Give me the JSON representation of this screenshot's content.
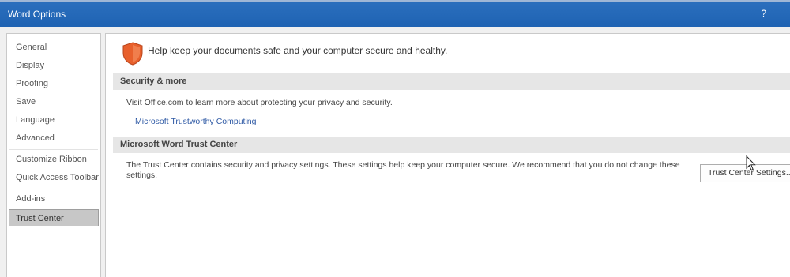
{
  "window": {
    "title": "Word Options",
    "help": "?"
  },
  "nav": {
    "items": [
      {
        "label": "General"
      },
      {
        "label": "Display"
      },
      {
        "label": "Proofing"
      },
      {
        "label": "Save"
      },
      {
        "label": "Language"
      },
      {
        "label": "Advanced"
      },
      {
        "label": "Customize Ribbon"
      },
      {
        "label": "Quick Access Toolbar"
      },
      {
        "label": "Add-ins"
      },
      {
        "label": "Trust Center"
      }
    ],
    "selected": "Trust Center"
  },
  "content": {
    "intro": "Help keep your documents safe and your computer secure and healthy.",
    "security_section": {
      "header": "Security & more",
      "text": "Visit Office.com to learn more about protecting your privacy and security.",
      "link": "Microsoft Trustworthy Computing"
    },
    "trust_center_section": {
      "header": "Microsoft Word Trust Center",
      "text_line1": "The Trust Center contains security and privacy settings. These settings help keep your computer secure. We recommend that you do not change these",
      "text_line2": "settings.",
      "button": "Trust Center Settings..."
    }
  },
  "icons": {
    "shield": "shield-icon",
    "cursor": "mouse-pointer-icon"
  },
  "colors": {
    "title_bar": "#2b6fbd",
    "shield": "#e8602c",
    "link": "#2f5aa5",
    "selected_nav": "#c7c7c7"
  }
}
